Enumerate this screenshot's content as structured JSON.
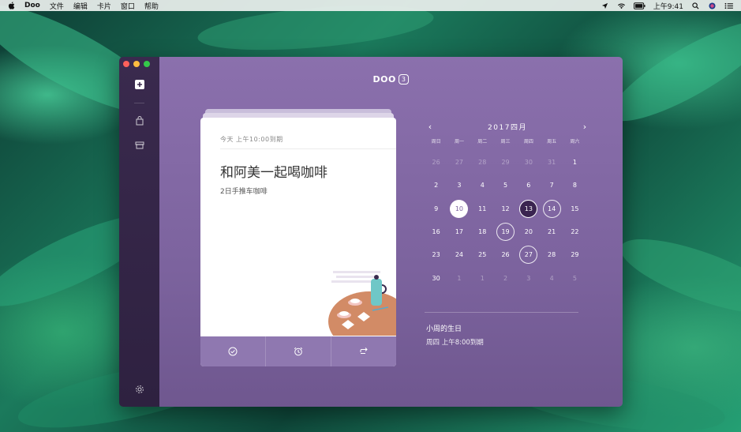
{
  "menubar": {
    "app_name": "Doo",
    "menus": [
      "文件",
      "编辑",
      "卡片",
      "窗口",
      "帮助"
    ],
    "clock": "上午9:41"
  },
  "app": {
    "logo_text": "DOO",
    "logo_version": "3"
  },
  "card": {
    "due": "今天 上午10:00到期",
    "title": "和阿美一起喝咖啡",
    "note": "2日手推车咖啡"
  },
  "calendar": {
    "month_label": "2017四月",
    "prev_label": "‹",
    "next_label": "›",
    "weekdays": [
      "周日",
      "周一",
      "周二",
      "周三",
      "周四",
      "周五",
      "周六"
    ],
    "days": [
      {
        "n": "26",
        "state": "dim"
      },
      {
        "n": "27",
        "state": "dim"
      },
      {
        "n": "28",
        "state": "dim"
      },
      {
        "n": "29",
        "state": "dim"
      },
      {
        "n": "30",
        "state": "dim"
      },
      {
        "n": "31",
        "state": "dim"
      },
      {
        "n": "1",
        "state": ""
      },
      {
        "n": "2",
        "state": ""
      },
      {
        "n": "3",
        "state": ""
      },
      {
        "n": "4",
        "state": ""
      },
      {
        "n": "5",
        "state": ""
      },
      {
        "n": "6",
        "state": ""
      },
      {
        "n": "7",
        "state": ""
      },
      {
        "n": "8",
        "state": ""
      },
      {
        "n": "9",
        "state": ""
      },
      {
        "n": "10",
        "state": "today"
      },
      {
        "n": "11",
        "state": ""
      },
      {
        "n": "12",
        "state": ""
      },
      {
        "n": "13",
        "state": "sel"
      },
      {
        "n": "14",
        "state": "ring"
      },
      {
        "n": "15",
        "state": ""
      },
      {
        "n": "16",
        "state": ""
      },
      {
        "n": "17",
        "state": ""
      },
      {
        "n": "18",
        "state": ""
      },
      {
        "n": "19",
        "state": "ring"
      },
      {
        "n": "20",
        "state": ""
      },
      {
        "n": "21",
        "state": ""
      },
      {
        "n": "22",
        "state": ""
      },
      {
        "n": "23",
        "state": ""
      },
      {
        "n": "24",
        "state": ""
      },
      {
        "n": "25",
        "state": ""
      },
      {
        "n": "26",
        "state": ""
      },
      {
        "n": "27",
        "state": "ring"
      },
      {
        "n": "28",
        "state": ""
      },
      {
        "n": "29",
        "state": ""
      },
      {
        "n": "30",
        "state": ""
      },
      {
        "n": "1",
        "state": "dim"
      },
      {
        "n": "1",
        "state": "dim"
      },
      {
        "n": "2",
        "state": "dim"
      },
      {
        "n": "3",
        "state": "dim"
      },
      {
        "n": "4",
        "state": "dim"
      },
      {
        "n": "5",
        "state": "dim"
      }
    ]
  },
  "event": {
    "title": "小周的生日",
    "time": "周四 上午8:00到期"
  },
  "colors": {
    "sidebar": "#3a2a4e",
    "main": "#8b70ad",
    "selected_day": "#3a2450",
    "action_bar": "#8f78b0"
  }
}
